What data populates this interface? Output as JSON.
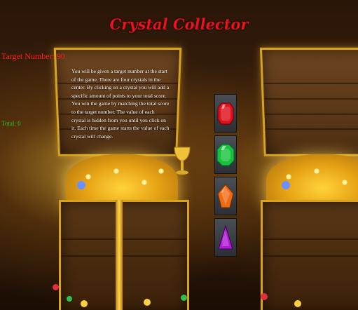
{
  "title": "Crystal Collector",
  "target_label": "Target Number: ",
  "target_value": "90",
  "total_label": "Total: ",
  "total_value": "0",
  "instructions": "You will be given a target number at the start of the game. There are four crystals in the center. By clicking on a crystal you will add a specific amount of points to your total score. You win the game by matching the total score to the target number. The value of each crystal is hidden from you until you click on it. Each time the game starts the value of each crystal will change.",
  "crystals": [
    {
      "name": "red-crystal",
      "color": "#e0101c"
    },
    {
      "name": "green-crystal",
      "color": "#17c23a"
    },
    {
      "name": "orange-crystal",
      "color": "#f06a12"
    },
    {
      "name": "purple-crystal",
      "color": "#b21ad6"
    }
  ]
}
